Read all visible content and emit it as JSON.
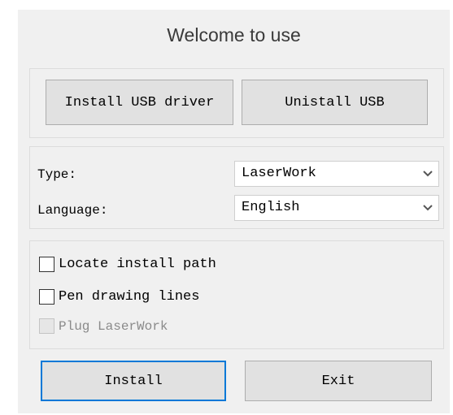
{
  "window": {
    "title": "Welcome to use"
  },
  "usb": {
    "install_label": "Install USB driver",
    "uninstall_label": "Unistall USB"
  },
  "settings": {
    "type_label": "Type:",
    "type_value": "LaserWork",
    "language_label": "Language:",
    "language_value": "English"
  },
  "options": {
    "locate_label": "Locate install path",
    "locate_checked": false,
    "pen_label": "Pen drawing lines",
    "pen_checked": false,
    "plug_label": "Plug LaserWork",
    "plug_checked": false,
    "plug_enabled": false
  },
  "actions": {
    "install_label": "Install",
    "exit_label": "Exit"
  },
  "icons": {
    "dropdown": "chevron-down-icon",
    "checkbox": "checkbox-icon"
  },
  "colors": {
    "window_bg": "#f0f0f0",
    "focus_border": "#0078d7",
    "button_bg": "#e1e1e1"
  }
}
